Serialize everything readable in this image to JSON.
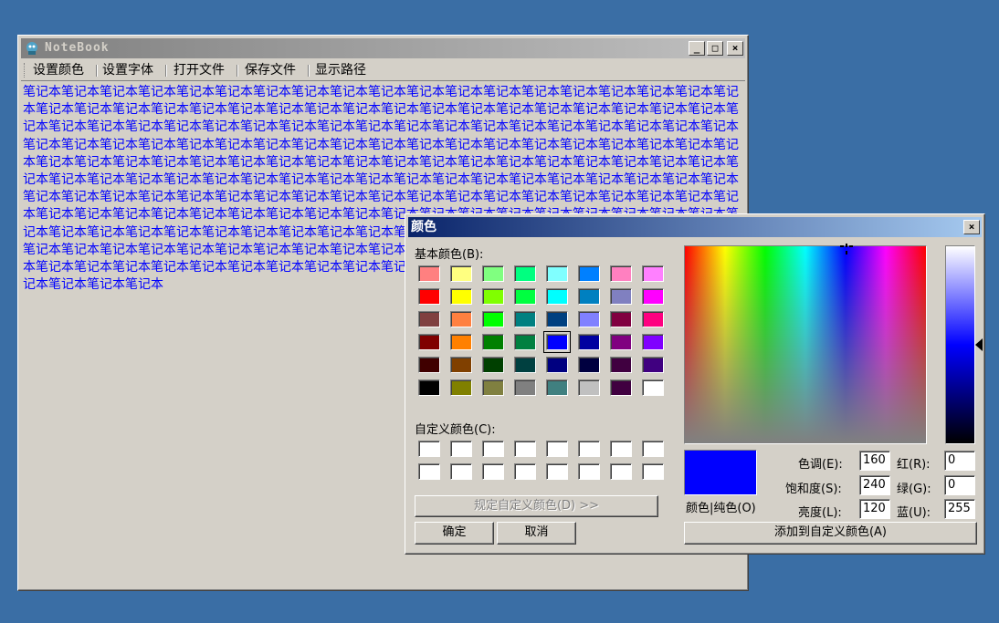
{
  "notebook": {
    "title": "NoteBook",
    "icon": "notebook-app-icon",
    "controls": {
      "minimize": "_",
      "maximize": "□",
      "close": "×"
    },
    "menu": [
      "设置颜色",
      "设置字体",
      "打开文件",
      "保存文件",
      "显示路径"
    ],
    "text_unit": "笔记本",
    "text_color": "#0000FF"
  },
  "dialog": {
    "title": "颜色",
    "close": "×",
    "basic_label": "基本颜色(B):",
    "basic_colors": [
      "#FF8080",
      "#FFFF80",
      "#80FF80",
      "#00FF80",
      "#80FFFF",
      "#0080FF",
      "#FF80C0",
      "#FF80FF",
      "#FF0000",
      "#FFFF00",
      "#80FF00",
      "#00FF40",
      "#00FFFF",
      "#0080C0",
      "#8080C0",
      "#FF00FF",
      "#804040",
      "#FF8040",
      "#00FF00",
      "#008080",
      "#004080",
      "#8080FF",
      "#800040",
      "#FF0080",
      "#800000",
      "#FF8000",
      "#008000",
      "#008040",
      "#0000FF",
      "#0000A0",
      "#800080",
      "#8000FF",
      "#400000",
      "#804000",
      "#004000",
      "#004040",
      "#000080",
      "#000040",
      "#400040",
      "#400080",
      "#000000",
      "#808000",
      "#808040",
      "#808080",
      "#408080",
      "#C0C0C0",
      "#400040",
      "#FFFFFF"
    ],
    "selected_index": 28,
    "custom_label": "自定义颜色(C):",
    "custom_colors": [
      "#FFFFFF",
      "#FFFFFF",
      "#FFFFFF",
      "#FFFFFF",
      "#FFFFFF",
      "#FFFFFF",
      "#FFFFFF",
      "#FFFFFF",
      "#FFFFFF",
      "#FFFFFF",
      "#FFFFFF",
      "#FFFFFF",
      "#FFFFFF",
      "#FFFFFF",
      "#FFFFFF",
      "#FFFFFF"
    ],
    "define_custom_button": "规定自定义颜色(D) >>",
    "ok_button": "确定",
    "cancel_button": "取消",
    "color_solid_label": "颜色|纯色(O)",
    "current_color": "#0000FF",
    "hue_label": "色调(E):",
    "hue_value": "160",
    "sat_label": "饱和度(S):",
    "sat_value": "240",
    "lum_label": "亮度(L):",
    "lum_value": "120",
    "red_label": "红(R):",
    "red_value": "0",
    "green_label": "绿(G):",
    "green_value": "0",
    "blue_label": "蓝(U):",
    "blue_value": "255",
    "add_custom_button": "添加到自定义颜色(A)"
  }
}
